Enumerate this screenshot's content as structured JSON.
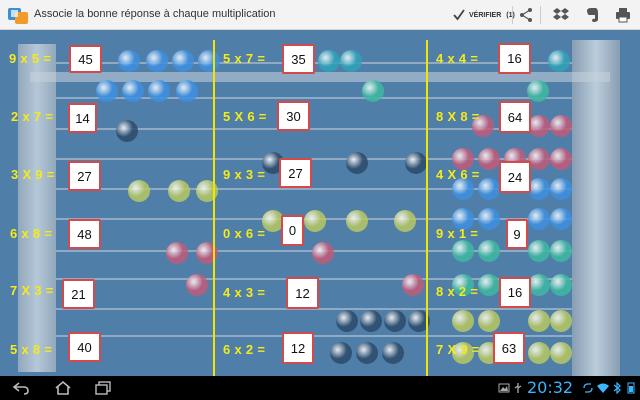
{
  "app": {
    "title": "Associe la bonne réponse à chaque multiplication",
    "verify_label": "VÉRIFIER",
    "verify_count": "(1)"
  },
  "toolbar_icons": [
    "check-icon",
    "share-icon",
    "dropbox-icon",
    "evernote-icon",
    "print-icon"
  ],
  "colors": {
    "accent": "#f4ea1c",
    "answer_border": "#d44a4a",
    "background": "#4f7fa8",
    "clock": "#3cb4ff"
  },
  "columns": [
    {
      "rows": [
        {
          "question": "9 x 5 =",
          "answer": "45"
        },
        {
          "question": "2 x 7 =",
          "answer": "14"
        },
        {
          "question": "3 X 9 =",
          "answer": "27"
        },
        {
          "question": "6 x 8 =",
          "answer": "48"
        },
        {
          "question": "7 X 3 =",
          "answer": "21"
        },
        {
          "question": "5 x 8 =",
          "answer": "40"
        }
      ]
    },
    {
      "rows": [
        {
          "question": "5 x 7 =",
          "answer": "35"
        },
        {
          "question": "5 X 6 =",
          "answer": "30"
        },
        {
          "question": "9 x 3 =",
          "answer": "27"
        },
        {
          "question": "0 x 6 =",
          "answer": "0"
        },
        {
          "question": "4 x 3 =",
          "answer": "12"
        },
        {
          "question": "6 x 2 =",
          "answer": "12"
        }
      ]
    },
    {
      "rows": [
        {
          "question": "4 x 4 =",
          "answer": "16"
        },
        {
          "question": "8 X 8 =",
          "answer": "64"
        },
        {
          "question": "4 X 6 =",
          "answer": "24"
        },
        {
          "question": "9 x 1 =",
          "answer": "9"
        },
        {
          "question": "8 x 2 =",
          "answer": "16"
        },
        {
          "question": "7 X 9 =",
          "answer": "63"
        }
      ]
    }
  ],
  "status_bar": {
    "time": "20:32"
  }
}
